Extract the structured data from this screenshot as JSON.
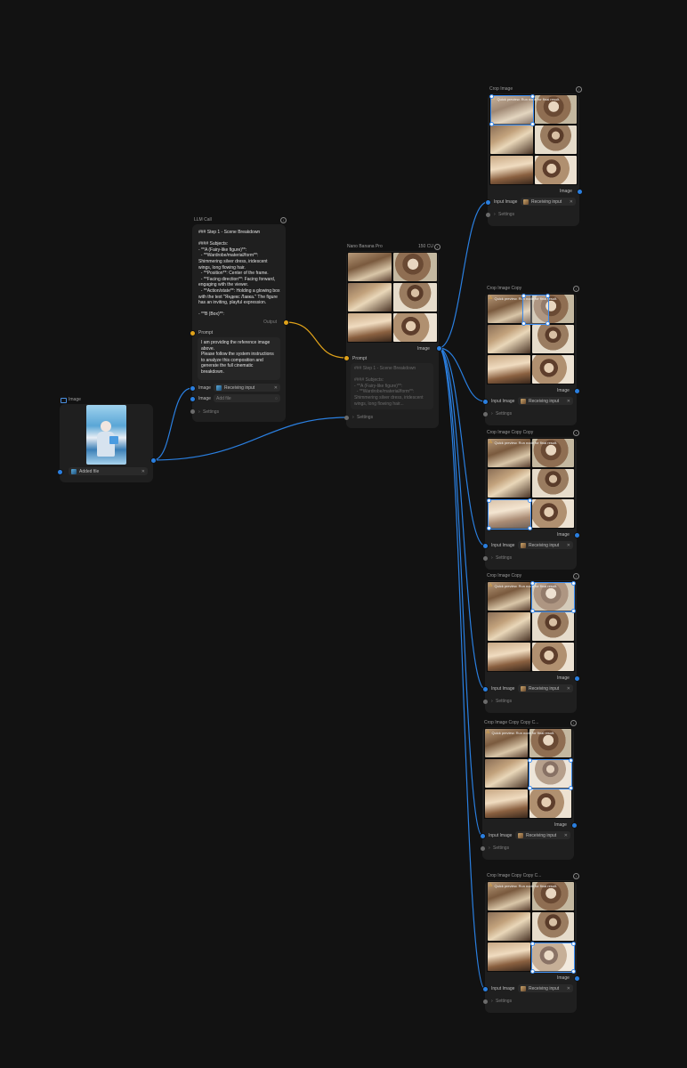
{
  "nodes": {
    "image": {
      "title": "Image",
      "file_label": "Added file"
    },
    "llm": {
      "title": "LLM Call",
      "output_text": [
        "### Step 1 - Scene Breakdown",
        "",
        "#### Subjects:",
        "- **A (Fairy-like figure)**:",
        "  - **Wardrobe/material/form**:",
        "Shimmering silver dress, iridescent",
        "wings, long flowing hair.",
        "  - **Position**: Center of the frame.",
        "  - **Facing direction**: Facing forward,",
        "engaging with the viewer.",
        "  - **Action/state**: Holding a glowing box",
        "with the text \"Яндекс Лавка.\" The figure",
        "has an inviting, playful expression.",
        "",
        "- **B (Box)**:"
      ],
      "output_label": "Output",
      "prompt_label": "Prompt",
      "prompt_text": [
        "I am providing the reference image",
        "above.",
        "Please follow the system instructions",
        "to analyze this composition and",
        "generate the full cinematic",
        "breakdown."
      ],
      "image_label_1": "Image",
      "image_value_1": "Receiving input",
      "image_label_2": "Image",
      "image_value_2": "Add file",
      "settings_label": "Settings"
    },
    "nano": {
      "title": "Nano Banana Pro",
      "cost": "150 CU",
      "image_label": "Image",
      "prompt_label": "Prompt",
      "prompt_text": [
        "### Step 1 - Scene Breakdown",
        "",
        "#### Subjects:",
        "- **A (Fairy-like figure)**:",
        "  - **Wardrobe/material/form**:",
        "Shimmering silver dress, iridescent",
        "wings, long flowing hair..."
      ],
      "settings_label": "Settings"
    },
    "crops": [
      {
        "title": "Crop Image",
        "warning": "Quick preview. Run node for final result.",
        "output_label": "Image",
        "input_label": "Input Image",
        "input_value": "Receiving input",
        "settings_label": "Settings"
      },
      {
        "title": "Crop Image Copy",
        "warning": "Quick preview. Run node for final result.",
        "output_label": "Image",
        "input_label": "Input Image",
        "input_value": "Receiving input",
        "settings_label": "Settings"
      },
      {
        "title": "Crop Image Copy Copy",
        "warning": "Quick preview. Run node for final result.",
        "output_label": "Image",
        "input_label": "Input Image",
        "input_value": "Receiving input",
        "settings_label": "Settings"
      },
      {
        "title": "Crop Image Copy",
        "warning": "Quick preview. Run node for final result.",
        "output_label": "Image",
        "input_label": "Input Image",
        "input_value": "Receiving input",
        "settings_label": "Settings"
      },
      {
        "title": "Crop Image Copy Copy C...",
        "warning": "Quick preview. Run node for final result.",
        "output_label": "Image",
        "input_label": "Input Image",
        "input_value": "Receiving input",
        "settings_label": "Settings"
      },
      {
        "title": "Crop Image Copy Copy C...",
        "warning": "Quick preview. Run node for final result.",
        "output_label": "Image",
        "input_label": "Input Image",
        "input_value": "Receiving input",
        "settings_label": "Settings"
      }
    ]
  },
  "colors": {
    "canvas": "#121212",
    "node": "#1f1f1f",
    "wire_image": "#2a7fe0",
    "wire_text": "#e0a21a"
  }
}
